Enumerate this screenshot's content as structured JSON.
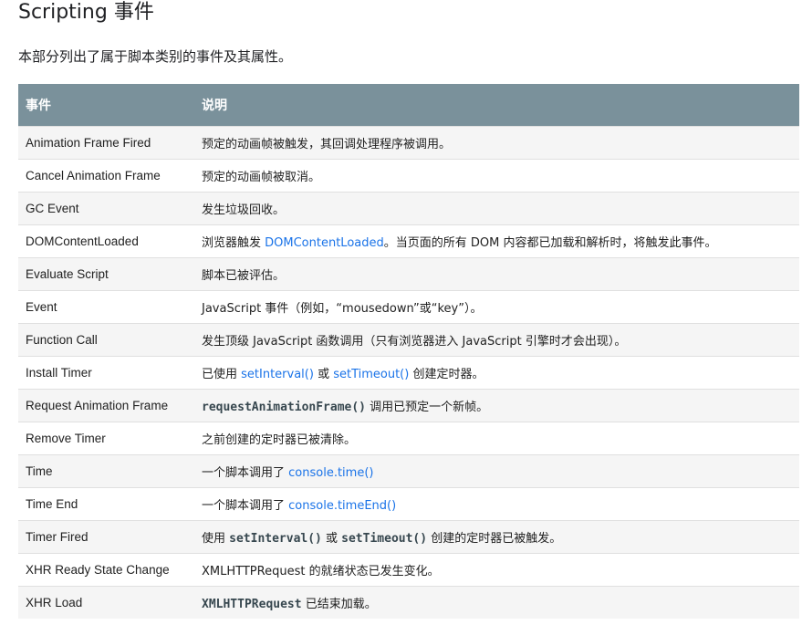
{
  "page": {
    "title": "Scripting 事件",
    "intro": "本部分列出了属于脚本类别的事件及其属性。"
  },
  "table": {
    "headers": [
      "事件",
      "说明"
    ],
    "rows": [
      {
        "event": "Animation Frame Fired",
        "desc": [
          {
            "t": "预定的动画帧被触发，其回调处理程序被调用。"
          }
        ]
      },
      {
        "event": "Cancel Animation Frame",
        "desc": [
          {
            "t": "预定的动画帧被取消。"
          }
        ]
      },
      {
        "event": "GC Event",
        "desc": [
          {
            "t": "发生垃圾回收。"
          }
        ]
      },
      {
        "event": "DOMContentLoaded",
        "desc": [
          {
            "t": "浏览器触发 "
          },
          {
            "t": "DOMContentLoaded",
            "k": "link"
          },
          {
            "t": "。当页面的所有 DOM 内容都已加载和解析时，将触发此事件。"
          }
        ]
      },
      {
        "event": "Evaluate Script",
        "desc": [
          {
            "t": "脚本已被评估。"
          }
        ]
      },
      {
        "event": "Event",
        "desc": [
          {
            "t": "JavaScript 事件（例如，“mousedown”或“key”）。"
          }
        ]
      },
      {
        "event": "Function Call",
        "desc": [
          {
            "t": "发生顶级 JavaScript 函数调用（只有浏览器进入 JavaScript 引擎时才会出现）。"
          }
        ]
      },
      {
        "event": "Install Timer",
        "desc": [
          {
            "t": "已使用 "
          },
          {
            "t": "setInterval()",
            "k": "link"
          },
          {
            "t": " 或 "
          },
          {
            "t": "setTimeout()",
            "k": "link"
          },
          {
            "t": " 创建定时器。"
          }
        ]
      },
      {
        "event": "Request Animation Frame",
        "desc": [
          {
            "t": "requestAnimationFrame()",
            "k": "code"
          },
          {
            "t": " 调用已预定一个新帧。"
          }
        ]
      },
      {
        "event": "Remove Timer",
        "desc": [
          {
            "t": "之前创建的定时器已被清除。"
          }
        ]
      },
      {
        "event": "Time",
        "desc": [
          {
            "t": "一个脚本调用了 "
          },
          {
            "t": "console.time()",
            "k": "link"
          }
        ]
      },
      {
        "event": "Time End",
        "desc": [
          {
            "t": "一个脚本调用了 "
          },
          {
            "t": "console.timeEnd()",
            "k": "link"
          }
        ]
      },
      {
        "event": "Timer Fired",
        "desc": [
          {
            "t": "使用 "
          },
          {
            "t": "setInterval()",
            "k": "code"
          },
          {
            "t": " 或 "
          },
          {
            "t": "setTimeout()",
            "k": "code"
          },
          {
            "t": " 创建的定时器已被触发。"
          }
        ]
      },
      {
        "event": "XHR Ready State Change",
        "desc": [
          {
            "t": "XMLHTTPRequest 的就绪状态已发生变化。"
          }
        ]
      },
      {
        "event": "XHR Load",
        "desc": [
          {
            "t": "XMLHTTPRequest",
            "k": "code"
          },
          {
            "t": " 已结束加载。"
          }
        ]
      }
    ]
  }
}
